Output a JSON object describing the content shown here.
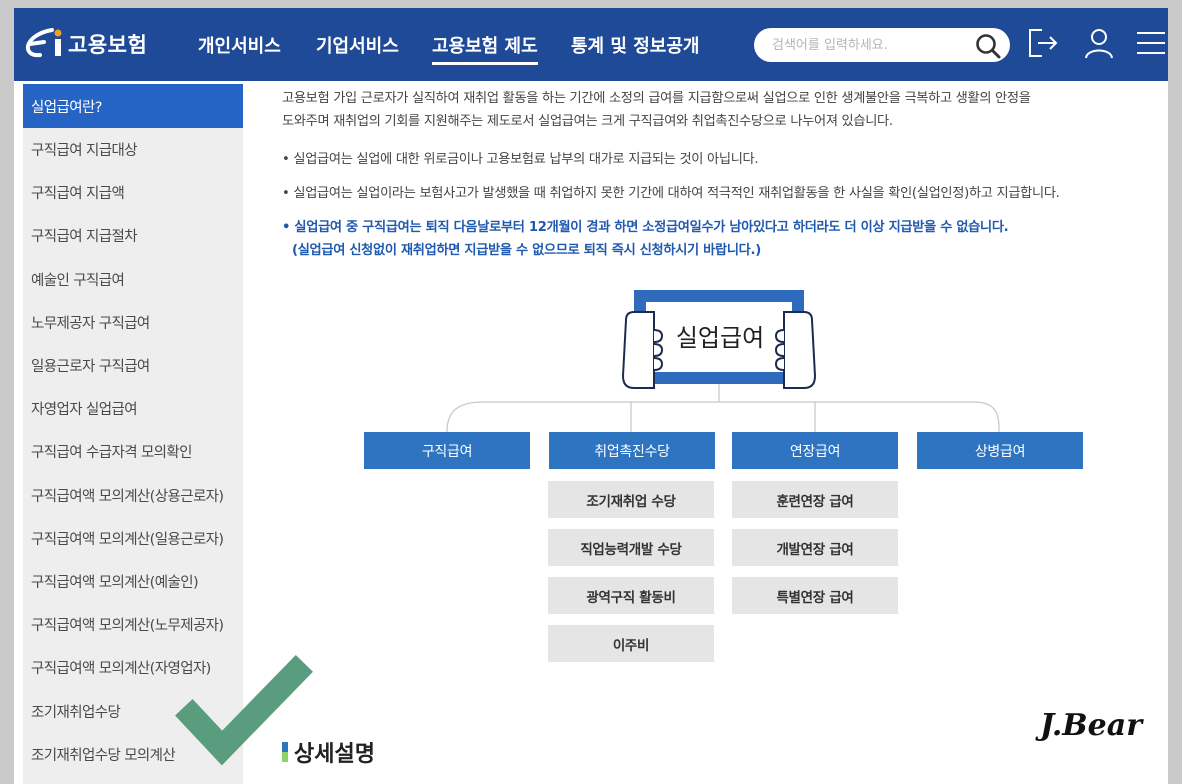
{
  "header": {
    "logo_text": "고용보험",
    "nav": [
      "개인서비스",
      "기업서비스",
      "고용보험 제도",
      "통계 및 정보공개"
    ],
    "active_nav_index": 2,
    "search_placeholder": "검색어를 입력하세요.",
    "icons": [
      "logout-icon",
      "user-icon",
      "menu-icon"
    ]
  },
  "sidebar": {
    "items": [
      "실업급여란?",
      "구직급여 지급대상",
      "구직급여 지급액",
      "구직급여 지급절차",
      "예술인 구직급여",
      "노무제공자 구직급여",
      "일용근로자 구직급여",
      "자영업자 실업급여",
      "구직급여 수급자격 모의확인",
      "구직급여액 모의계산(상용근로자)",
      "구직급여액 모의계산(일용근로자)",
      "구직급여액 모의계산(예술인)",
      "구직급여액 모의계산(노무제공자)",
      "구직급여액 모의계산(자영업자)",
      "조기재취업수당",
      "조기재취업수당 모의계산"
    ],
    "active_index": 0
  },
  "content": {
    "intro_line1": "고용보험 가입 근로자가 실직하여 재취업 활동을 하는 기간에 소정의 급여를 지급함으로써 실업으로 인한 생계불안을 극복하고 생활의 안정을",
    "intro_line2": "도와주며 재취업의 기회를 지원해주는 제도로서 실업급여는 크게 구직급여와 취업촉진수당으로 나누어져 있습니다.",
    "bullet1": "• 실업급여는 실업에 대한 위로금이나 고용보험료 납부의 대가로 지급되는 것이 아닙니다.",
    "bullet2": "• 실업급여는 실업이라는 보험사고가 발생했을 때 취업하지 못한 기간에 대하여 적극적인 재취업활동을 한 사실을 확인(실업인정)하고 지급합니다.",
    "bullet3_line1": "• 실업급여 중 구직급여는 퇴직 다음날로부터 12개월이 경과 하면 소정급여일수가 남아있다고 하더라도 더 이상 지급받을 수 없습니다.",
    "bullet3_line2": "(실업급여 신청없이 재취업하면 지급받을 수 없으므로 퇴직 즉시 신청하시기 바랍니다.)"
  },
  "diagram": {
    "root": "실업급여",
    "categories": [
      "구직급여",
      "취업촉진수당",
      "연장급여",
      "상병급여"
    ],
    "promotion_items": [
      "조기재취업 수당",
      "직업능력개발 수당",
      "광역구직 활동비",
      "이주비"
    ],
    "extension_items": [
      "훈련연장 급여",
      "개발연장 급여",
      "특별연장 급여"
    ]
  },
  "detail_heading": "상세설명",
  "signature": "J.Bear",
  "colors": {
    "header_bg": "#1f4a98",
    "accent_blue": "#2f74c0",
    "sidebar_active": "#2563c4",
    "highlight_text": "#2059b0",
    "check_green": "#5a9c7e"
  }
}
